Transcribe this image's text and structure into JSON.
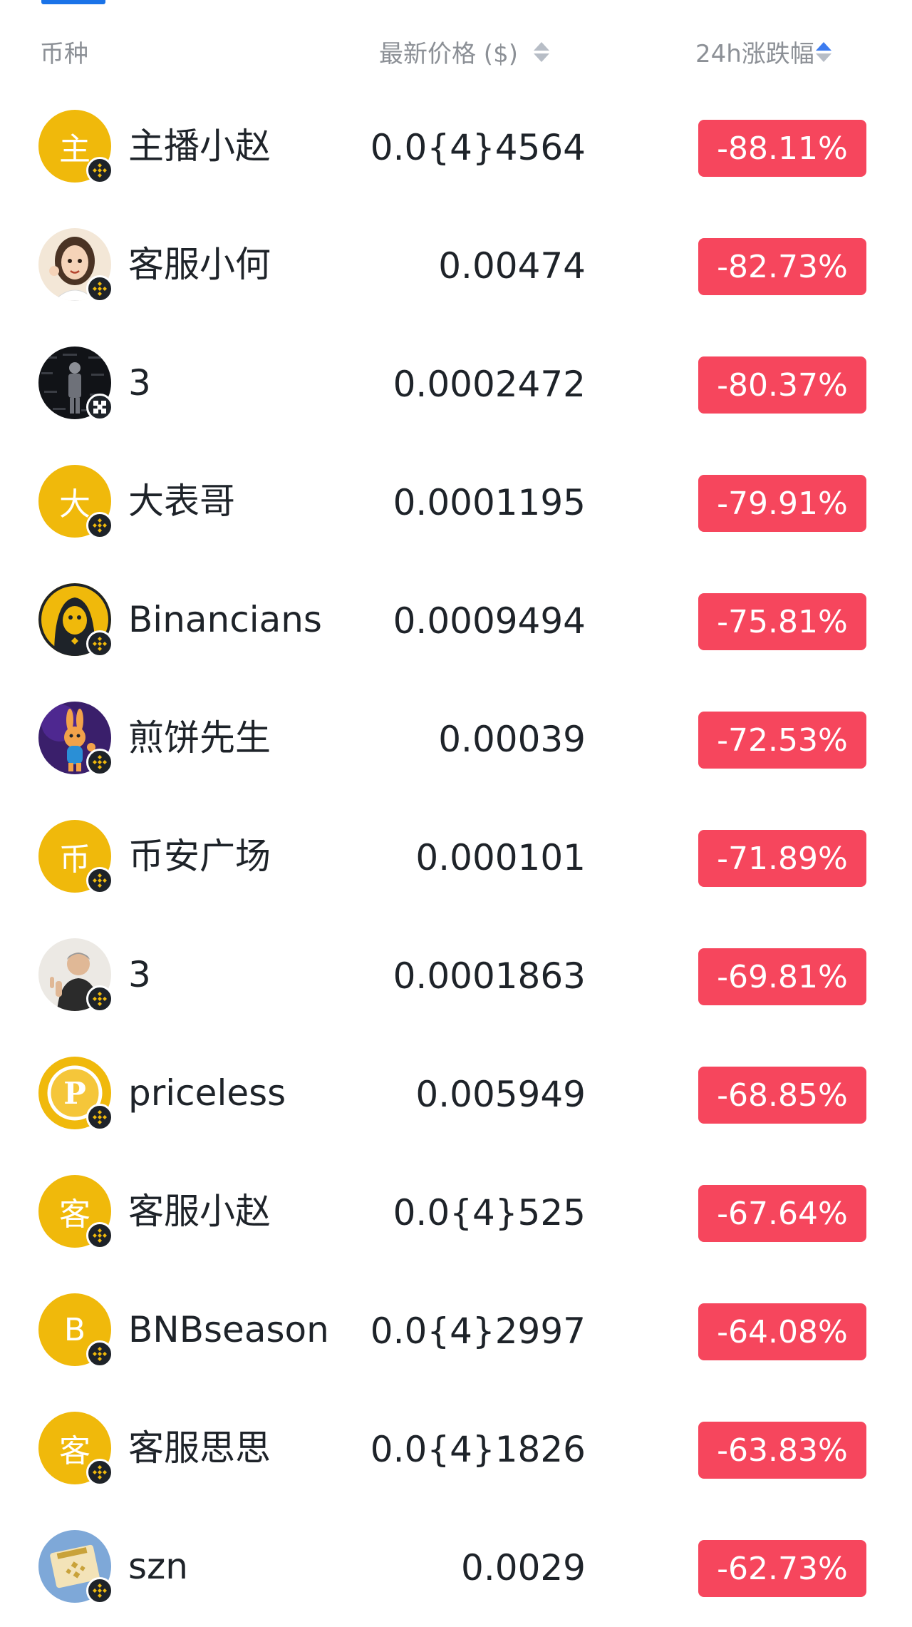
{
  "header": {
    "coin_label": "币种",
    "price_label": "最新价格 ($)",
    "change_label": "24h涨跌幅"
  },
  "colors": {
    "accent": "#1a73e8",
    "negative": "#f6465d",
    "avatar_yellow": "#f0b90b"
  },
  "rows": [
    {
      "avatar_letter": "主",
      "avatar_icon": "letter-avatar",
      "badge_icon": "bnb-chain-icon",
      "name": "主播小赵",
      "price": "0.0{4}4564",
      "change": "-88.11%"
    },
    {
      "avatar_letter": "",
      "avatar_icon": "cartoon-girl-avatar",
      "badge_icon": "bnb-chain-icon",
      "name": "客服小何",
      "price": "0.00474",
      "change": "-82.73%"
    },
    {
      "avatar_letter": "",
      "avatar_icon": "photo-person-avatar",
      "badge_icon": "other-chain-icon",
      "name": "3",
      "price": "0.0002472",
      "change": "-80.37%"
    },
    {
      "avatar_letter": "大",
      "avatar_icon": "letter-avatar",
      "badge_icon": "bnb-chain-icon",
      "name": "大表哥",
      "price": "0.0001195",
      "change": "-79.91%"
    },
    {
      "avatar_letter": "",
      "avatar_icon": "hooded-figure-avatar",
      "badge_icon": "bnb-chain-icon",
      "name": "Binancians",
      "price": "0.0009494",
      "change": "-75.81%"
    },
    {
      "avatar_letter": "",
      "avatar_icon": "rabbit-avatar",
      "badge_icon": "bnb-chain-icon",
      "name": "煎饼先生",
      "price": "0.00039",
      "change": "-72.53%"
    },
    {
      "avatar_letter": "币",
      "avatar_icon": "letter-avatar",
      "badge_icon": "bnb-chain-icon",
      "name": "币安广场",
      "price": "0.000101",
      "change": "-71.89%"
    },
    {
      "avatar_letter": "",
      "avatar_icon": "man-photo-avatar",
      "badge_icon": "bnb-chain-icon",
      "name": "3",
      "price": "0.0001863",
      "change": "-69.81%"
    },
    {
      "avatar_letter": "P",
      "avatar_icon": "coin-p-avatar",
      "badge_icon": "bnb-chain-icon",
      "name": "priceless",
      "price": "0.005949",
      "change": "-68.85%"
    },
    {
      "avatar_letter": "客",
      "avatar_icon": "letter-avatar",
      "badge_icon": "bnb-chain-icon",
      "name": "客服小赵",
      "price": "0.0{4}525",
      "change": "-67.64%"
    },
    {
      "avatar_letter": "B",
      "avatar_icon": "letter-avatar",
      "badge_icon": "bnb-chain-icon",
      "name": "BNBseason",
      "price": "0.0{4}2997",
      "change": "-64.08%"
    },
    {
      "avatar_letter": "客",
      "avatar_icon": "letter-avatar",
      "badge_icon": "bnb-chain-icon",
      "name": "客服思思",
      "price": "0.0{4}1826",
      "change": "-63.83%"
    },
    {
      "avatar_letter": "",
      "avatar_icon": "bnb-szn-sign-avatar",
      "badge_icon": "bnb-chain-icon",
      "name": "szn",
      "price": "0.0029",
      "change": "-62.73%"
    }
  ]
}
